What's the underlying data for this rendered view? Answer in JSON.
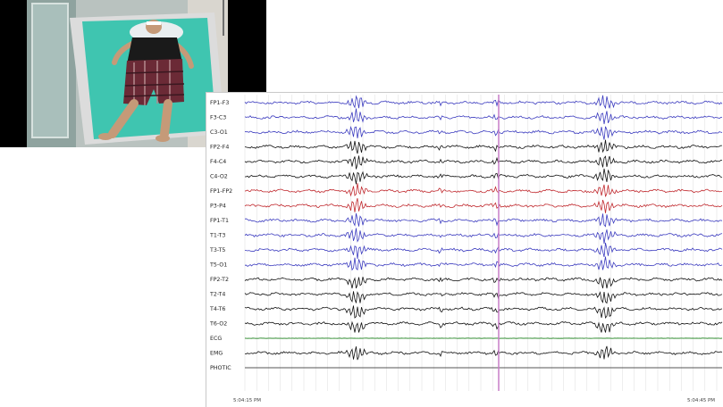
{
  "video": {
    "thumbnail": "patient-in-hospital-bed-video",
    "colors": {
      "sheet": "#3fc5b0",
      "shirt": "#1a1a1a",
      "shorts": "#6b2a36",
      "frame": "#000000"
    }
  },
  "eeg": {
    "channels": [
      {
        "label": "FP1-F3",
        "color": "#3b3bbf"
      },
      {
        "label": "F3-C3",
        "color": "#3b3bbf"
      },
      {
        "label": "C3-O1",
        "color": "#3b3bbf"
      },
      {
        "label": "FP2-F4",
        "color": "#111111"
      },
      {
        "label": "F4-C4",
        "color": "#111111"
      },
      {
        "label": "C4-O2",
        "color": "#111111"
      },
      {
        "label": "FP1-FP2",
        "color": "#c0282d"
      },
      {
        "label": "P3-P4",
        "color": "#c0282d"
      },
      {
        "label": "FP1-T1",
        "color": "#3b3bbf"
      },
      {
        "label": "T1-T3",
        "color": "#3b3bbf"
      },
      {
        "label": "T3-T5",
        "color": "#3b3bbf"
      },
      {
        "label": "T5-O1",
        "color": "#3b3bbf"
      },
      {
        "label": "FP2-T2",
        "color": "#111111"
      },
      {
        "label": "T2-T4",
        "color": "#111111"
      },
      {
        "label": "T4-T6",
        "color": "#111111"
      },
      {
        "label": "T6-O2",
        "color": "#111111"
      },
      {
        "label": "ECG",
        "color": "#4a9a4a"
      },
      {
        "label": "EMG",
        "color": "#111111"
      },
      {
        "label": "PHOTIC",
        "color": "#555555"
      }
    ],
    "time_start": "5:04:15 PM",
    "time_end": "5:04:45 PM",
    "marker_color": "#c77dc7",
    "grid_color": "#dcdcdc"
  }
}
